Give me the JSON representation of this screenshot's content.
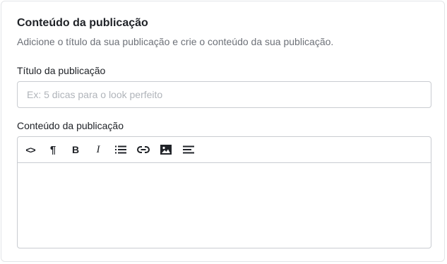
{
  "section": {
    "title": "Conteúdo da publicação",
    "description": "Adicione o título da sua publicação e crie o conteúdo da sua publicação."
  },
  "title_field": {
    "label": "Título da publicação",
    "placeholder": "Ex: 5 dicas para o look perfeito",
    "value": ""
  },
  "content_field": {
    "label": "Conteúdo da publicação",
    "value": ""
  },
  "toolbar": {
    "buttons": [
      {
        "icon": "code-icon",
        "glyph": "<>"
      },
      {
        "icon": "paragraph-icon",
        "glyph": "¶"
      },
      {
        "icon": "bold-icon",
        "glyph": "B"
      },
      {
        "icon": "italic-icon",
        "glyph": "I"
      },
      {
        "icon": "bullet-list-icon"
      },
      {
        "icon": "link-icon"
      },
      {
        "icon": "image-icon"
      },
      {
        "icon": "align-left-icon"
      }
    ]
  }
}
